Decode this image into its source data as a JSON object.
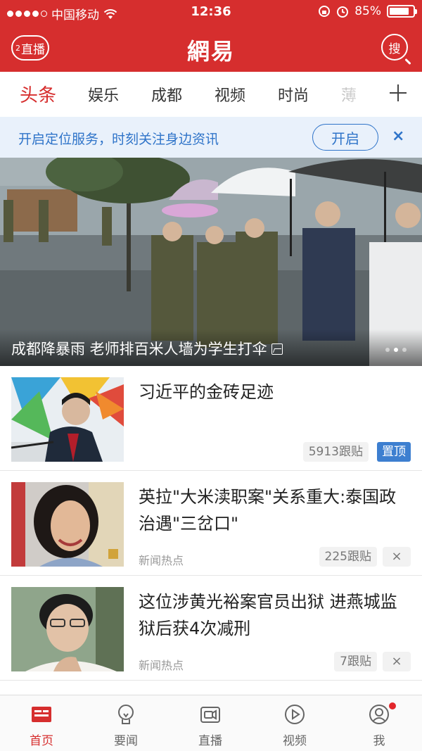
{
  "status_bar": {
    "carrier": "中国移动",
    "time": "12:36",
    "battery": "85%",
    "battery_level": 0.85
  },
  "header": {
    "live_count": "2",
    "live_label": "直播",
    "logo": "網易",
    "search_label": "搜"
  },
  "tabs": [
    {
      "label": "头条",
      "active": true
    },
    {
      "label": "娱乐"
    },
    {
      "label": "成都"
    },
    {
      "label": "视频"
    },
    {
      "label": "时尚"
    },
    {
      "label": "薄"
    }
  ],
  "location_banner": {
    "text": "开启定位服务，时刻关注身边资讯",
    "button": "开启",
    "close": "×"
  },
  "hero": {
    "caption": "成都降暴雨 老师排百米人墙为学生打伞",
    "pages": 3,
    "current_page": 2
  },
  "news": [
    {
      "title": "习近平的金砖足迹",
      "comments": "5913跟贴",
      "tag": "置顶"
    },
    {
      "title": "英拉\"大米渎职案\"关系重大:泰国政治遇\"三岔口\"",
      "source": "新闻热点",
      "comments": "225跟贴",
      "dismiss": "×"
    },
    {
      "title": "这位涉黄光裕案官员出狱 进燕城监狱后获4次减刑",
      "source": "新闻热点",
      "comments": "7跟贴",
      "dismiss": "×"
    }
  ],
  "bottom_nav": [
    {
      "label": "首页",
      "icon": "home-icon",
      "active": true
    },
    {
      "label": "要闻",
      "icon": "lightbulb-icon"
    },
    {
      "label": "直播",
      "icon": "live-icon"
    },
    {
      "label": "视频",
      "icon": "video-play-icon"
    },
    {
      "label": "我",
      "icon": "profile-icon",
      "notification": true
    }
  ],
  "colors": {
    "brand_red": "#d62e2e",
    "link_blue": "#2f74c9",
    "pin_blue": "#3d7fd0"
  }
}
